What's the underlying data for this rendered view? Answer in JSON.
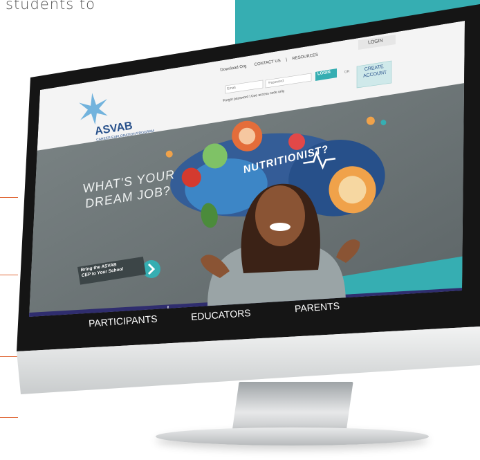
{
  "caption": "students to",
  "site": {
    "logo_text": "ASVAB",
    "logo_sub": "CAREER EXPLORATION PROGRAM",
    "top_links": [
      "Download Org",
      "CONTACT US",
      "RESOURCES"
    ],
    "login_tab": "LOGIN",
    "email_placeholder": "Email",
    "password_placeholder": "Password",
    "login_button": "LOGIN",
    "or_text": "OR",
    "create_account": [
      "CREATE",
      "ACCOUNT"
    ],
    "forgot_text": "Forgot password | Use access code only"
  },
  "hero": {
    "headline_line1": "WHAT'S YOUR",
    "headline_line2": "DREAM JOB?",
    "bubble_word": "NUTRITIONIST?",
    "cta_line1": "Bring the ASVAB",
    "cta_line2": "CEP to Your School"
  },
  "nav": [
    "PARTICIPANTS",
    "EDUCATORS",
    "PARENTS"
  ],
  "colors": {
    "teal": "#36aeb2",
    "navy": "#2f2d6e",
    "hero_bg": "#747d7e",
    "accent_orange": "#e06a3a"
  }
}
